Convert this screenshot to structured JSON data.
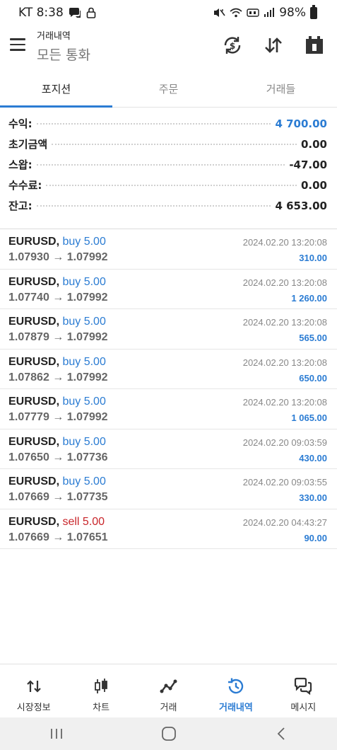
{
  "status_bar": {
    "carrier_time": "KT 8:38",
    "battery": "98%"
  },
  "app_bar": {
    "title_small": "거래내역",
    "title_big": "모든 통화"
  },
  "tabs": [
    {
      "label": "포지션",
      "active": true
    },
    {
      "label": "주문",
      "active": false
    },
    {
      "label": "거래들",
      "active": false
    }
  ],
  "summary": [
    {
      "label": "수익:",
      "value": "4 700.00",
      "highlight": true
    },
    {
      "label": "초기금액",
      "value": "0.00",
      "highlight": false
    },
    {
      "label": "스왑:",
      "value": "-47.00",
      "highlight": false
    },
    {
      "label": "수수료:",
      "value": "0.00",
      "highlight": false
    },
    {
      "label": "잔고:",
      "value": "4 653.00",
      "highlight": false
    }
  ],
  "trades": [
    {
      "symbol": "EURUSD,",
      "side": "buy",
      "side_text": "buy 5.00",
      "prices": "1.07930 → 1.07992",
      "time": "2024.02.20 13:20:08",
      "profit": "310.00"
    },
    {
      "symbol": "EURUSD,",
      "side": "buy",
      "side_text": "buy 5.00",
      "prices": "1.07740 → 1.07992",
      "time": "2024.02.20 13:20:08",
      "profit": "1 260.00"
    },
    {
      "symbol": "EURUSD,",
      "side": "buy",
      "side_text": "buy 5.00",
      "prices": "1.07879 → 1.07992",
      "time": "2024.02.20 13:20:08",
      "profit": "565.00"
    },
    {
      "symbol": "EURUSD,",
      "side": "buy",
      "side_text": "buy 5.00",
      "prices": "1.07862 → 1.07992",
      "time": "2024.02.20 13:20:08",
      "profit": "650.00"
    },
    {
      "symbol": "EURUSD,",
      "side": "buy",
      "side_text": "buy 5.00",
      "prices": "1.07779 → 1.07992",
      "time": "2024.02.20 13:20:08",
      "profit": "1 065.00"
    },
    {
      "symbol": "EURUSD,",
      "side": "buy",
      "side_text": "buy 5.00",
      "prices": "1.07650 → 1.07736",
      "time": "2024.02.20 09:03:59",
      "profit": "430.00"
    },
    {
      "symbol": "EURUSD,",
      "side": "buy",
      "side_text": "buy 5.00",
      "prices": "1.07669 → 1.07735",
      "time": "2024.02.20 09:03:55",
      "profit": "330.00"
    },
    {
      "symbol": "EURUSD,",
      "side": "sell",
      "side_text": "sell 5.00",
      "prices": "1.07669 → 1.07651",
      "time": "2024.02.20 04:43:27",
      "profit": "90.00"
    }
  ],
  "bottom_nav": [
    {
      "label": "시장정보",
      "icon": "quotes-arrows-icon",
      "active": false
    },
    {
      "label": "차트",
      "icon": "candlestick-chart-icon",
      "active": false
    },
    {
      "label": "거래",
      "icon": "trade-line-icon",
      "active": false
    },
    {
      "label": "거래내역",
      "icon": "history-clock-icon",
      "active": true
    },
    {
      "label": "메시지",
      "icon": "chat-bubbles-icon",
      "active": false
    }
  ],
  "colors": {
    "accent": "#2b7cd3",
    "sell": "#c9262b"
  }
}
